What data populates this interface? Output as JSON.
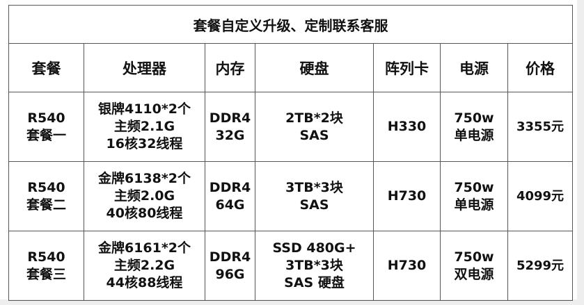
{
  "title": "套餐自定义升级、定制联系客服",
  "headers": [
    "套餐",
    "处理器",
    "内存",
    "硬盘",
    "阵列卡",
    "电源",
    "价格"
  ],
  "rows": [
    {
      "package": "R540\n套餐一",
      "cpu": "银牌4110*2个\n主频2.1G\n16核32线程",
      "memory": "DDR4\n32G",
      "disk": "2TB*2块\nSAS",
      "raid": "H330",
      "power": "750w\n单电源",
      "price": "3355元"
    },
    {
      "package": "R540\n套餐二",
      "cpu": "金牌6138*2个\n主频2.0G\n40核80线程",
      "memory": "DDR4\n64G",
      "disk": "3TB*3块\nSAS",
      "raid": "H730",
      "power": "750w\n单电源",
      "price": "4099元"
    },
    {
      "package": "R540\n套餐三",
      "cpu": "金牌6161*2个\n主频2.2G\n44核88线程",
      "memory": "DDR4\n96G",
      "disk": "SSD 480G+\n3TB*3块\nSAS 硬盘",
      "raid": "H730",
      "power": "750w\n双电源",
      "price": "5299元"
    }
  ]
}
